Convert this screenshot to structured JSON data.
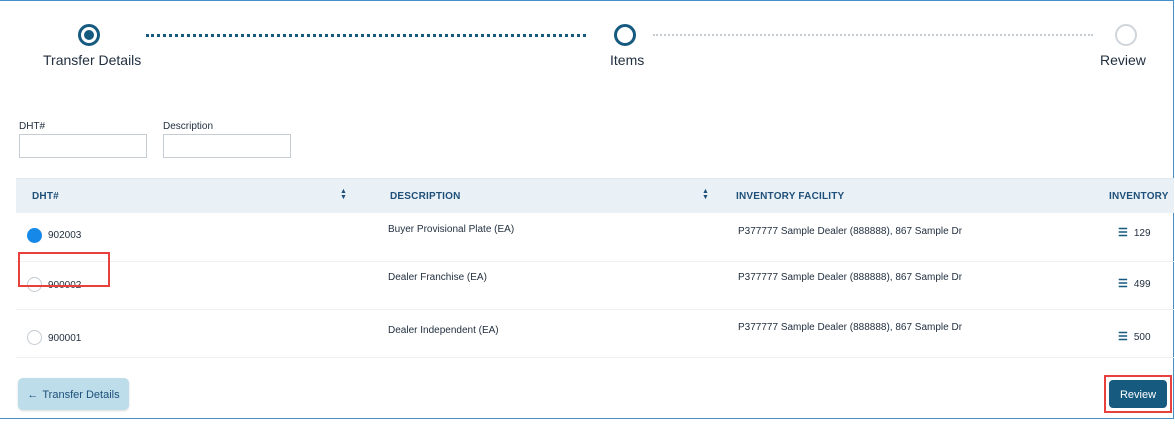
{
  "stepper": {
    "steps": [
      {
        "label": "Transfer Details",
        "state": "completed"
      },
      {
        "label": "Items",
        "state": "current"
      },
      {
        "label": "Review",
        "state": "upcoming"
      }
    ]
  },
  "filters": {
    "dht_label": "DHT#",
    "dht_value": "",
    "description_label": "Description",
    "description_value": ""
  },
  "table": {
    "columns": [
      "DHT#",
      "DESCRIPTION",
      "INVENTORY FACILITY",
      "INVENTORY"
    ],
    "rows": [
      {
        "selected": true,
        "dht": "902003",
        "description": "Buyer Provisional Plate (EA)",
        "facility": "P377777 Sample Dealer (888888), 867 Sample Dr",
        "inventory": "129"
      },
      {
        "selected": false,
        "dht": "900002",
        "description": "Dealer Franchise (EA)",
        "facility": "P377777 Sample Dealer (888888), 867 Sample Dr",
        "inventory": "499"
      },
      {
        "selected": false,
        "dht": "900001",
        "description": "Dealer Independent (EA)",
        "facility": "P377777 Sample Dealer (888888), 867 Sample Dr",
        "inventory": "500"
      }
    ]
  },
  "footer": {
    "back_label": "Transfer Details",
    "next_label": "Review"
  },
  "colors": {
    "primary": "#175a80",
    "selected_radio": "#1689e8",
    "highlight": "#e8403c",
    "header_bg": "#eaf1f6"
  }
}
